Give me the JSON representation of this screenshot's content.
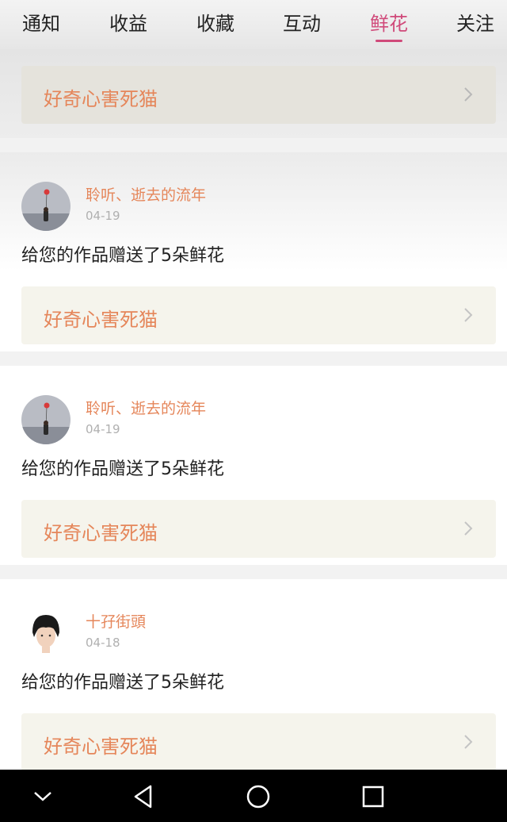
{
  "tabs": [
    {
      "label": "通知"
    },
    {
      "label": "收益"
    },
    {
      "label": "收藏"
    },
    {
      "label": "互动"
    },
    {
      "label": "鲜花"
    },
    {
      "label": "关注"
    }
  ],
  "active_tab": "鲜花",
  "top_work": {
    "title": "好奇心害死猫"
  },
  "items": [
    {
      "user": "聆听、逝去的流年",
      "date": "04-19",
      "message": "给您的作品赠送了5朵鲜花",
      "work_title": "好奇心害死猫",
      "avatar_icon": "balloon-girl-avatar"
    },
    {
      "user": "聆听、逝去的流年",
      "date": "04-19",
      "message": "给您的作品赠送了5朵鲜花",
      "work_title": "好奇心害死猫",
      "avatar_icon": "balloon-girl-avatar"
    },
    {
      "user": "十孖街頭",
      "date": "04-18",
      "message": "给您的作品赠送了5朵鲜花",
      "work_title": "好奇心害死猫",
      "avatar_icon": "short-hair-person-avatar"
    }
  ],
  "navbar": {
    "back_icon": "chevron-down-icon",
    "triangle_icon": "back-triangle-icon",
    "home_icon": "home-circle-icon",
    "recents_icon": "recents-square-icon"
  },
  "colors": {
    "accent": "#d04a7a",
    "name": "#e5865a",
    "card_box": "#f5f4ec"
  }
}
